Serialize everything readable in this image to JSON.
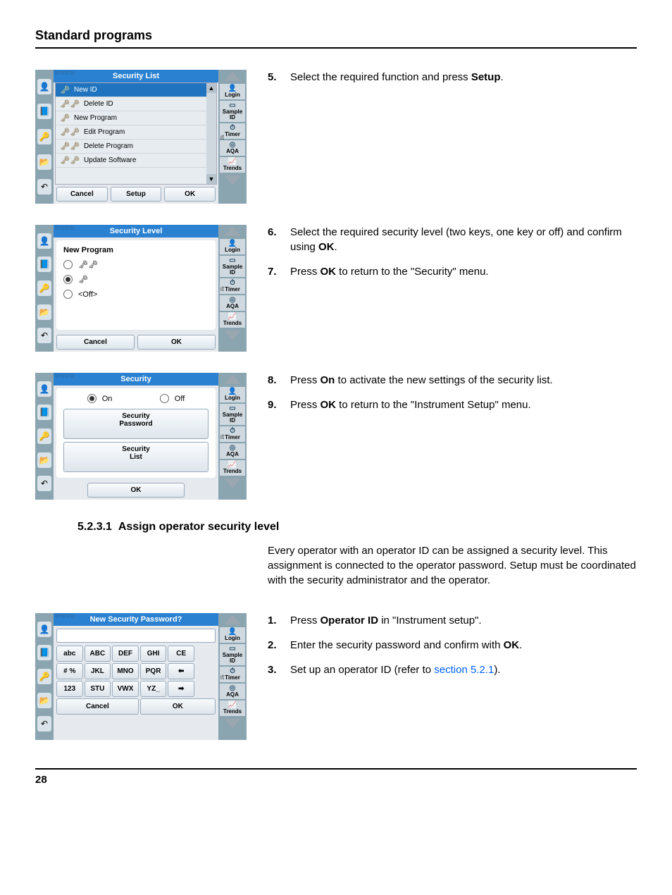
{
  "page": {
    "title": "Standard programs",
    "number": "28"
  },
  "section": {
    "number": "5.2.3.1",
    "title": "Assign operator security level"
  },
  "intro_para": "Every operator with an operator ID can be assigned a security level. This assignment is connected to the operator password. Setup must be coordinated with the security administrator and the operator.",
  "steps": {
    "s5": {
      "num": "5.",
      "pre": "Select the required function and press ",
      "bold": "Setup",
      "post": "."
    },
    "s6": {
      "num": "6.",
      "pre": "Select the required security level (two keys, one key or off) and confirm using ",
      "bold": "OK",
      "post": "."
    },
    "s7": {
      "num": "7.",
      "pre": "Press ",
      "bold": "OK",
      "post": " to return to the \"Security\" menu."
    },
    "s8": {
      "num": "8.",
      "pre": "Press ",
      "bold": "On",
      "post": " to activate the new settings of the security list."
    },
    "s9": {
      "num": "9.",
      "pre": "Press ",
      "bold": "OK",
      "post": " to return to the \"Instrument Setup\" menu."
    },
    "s1": {
      "num": "1.",
      "pre": "Press ",
      "bold": "Operator ID",
      "post": " in \"Instrument setup\"."
    },
    "s2": {
      "num": "2.",
      "pre": "Enter the security password and confirm with ",
      "bold": "OK",
      "post": "."
    },
    "s3": {
      "num": "3.",
      "pre": "Set up an operator ID (refer to ",
      "link": "section 5.2.1",
      "post": ")."
    }
  },
  "sidebar_right": {
    "items": [
      "Login",
      "Sample ID",
      "Timer",
      "AQA",
      "Trends"
    ]
  },
  "screens": {
    "instru_label": "Instru",
    "btns": {
      "cancel": "Cancel",
      "setup": "Setup",
      "ok": "OK"
    },
    "screen1": {
      "title": "Security List",
      "items": [
        {
          "label": "New ID",
          "keys": 1,
          "selected": true
        },
        {
          "label": "Delete ID",
          "keys": 2,
          "selected": false
        },
        {
          "label": "New Program",
          "keys": 1,
          "selected": false
        },
        {
          "label": "Edit Program",
          "keys": 2,
          "selected": false
        },
        {
          "label": "Delete Program",
          "keys": 2,
          "selected": false
        },
        {
          "label": "Update Software",
          "keys": 2,
          "selected": false
        }
      ]
    },
    "screen2": {
      "title": "Security Level",
      "heading": "New Program",
      "off_label": "<Off>"
    },
    "screen3": {
      "title": "Security",
      "on": "On",
      "off": "Off",
      "sec_pw": "Security\nPassword",
      "sec_list": "Security\nList"
    },
    "screen4": {
      "title": "New Security Password?",
      "keys": {
        "r1": [
          "abc",
          "ABC",
          "DEF",
          "GHI",
          "CE"
        ],
        "r2": [
          "# %",
          "JKL",
          "MNO",
          "PQR",
          "⬅"
        ],
        "r3": [
          "123",
          "STU",
          "VWX",
          "YZ_",
          "➡"
        ]
      }
    }
  }
}
